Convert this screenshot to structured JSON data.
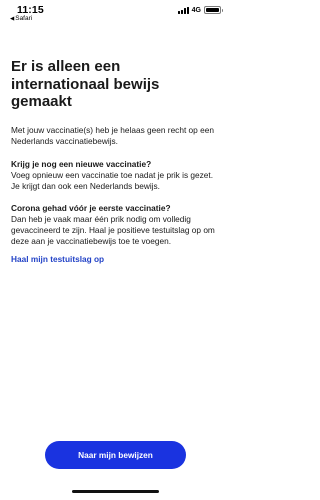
{
  "status_bar": {
    "time": "11:15",
    "back_app_label": "Safari",
    "network": "4G",
    "signal_bars": 4,
    "battery_level": 1.0
  },
  "main": {
    "title": "Er is alleen een internationaal bewijs gemaakt",
    "intro": "Met jouw vaccinatie(s) heb je helaas geen recht op een Nederlands vaccinatiebewijs.",
    "sections": [
      {
        "heading": "Krijg je nog een nieuwe vaccinatie?",
        "body": "Voeg opnieuw een vaccinatie toe nadat je prik is gezet. Je krijgt dan ook een Nederlands bewijs."
      },
      {
        "heading": "Corona gehad vóór je eerste vaccinatie?",
        "body": "Dan heb je vaak maar één prik nodig om volledig gevaccineerd te zijn. Haal je positieve testuitslag op om deze aan je vaccinatiebewijs toe te voegen."
      }
    ],
    "link_label": "Haal mijn testuitslag op",
    "primary_button_label": "Naar mijn bewijzen"
  },
  "colors": {
    "accent": "#1a33e0",
    "link": "#2343c7",
    "text": "#1a1a1a",
    "background": "#ffffff"
  }
}
